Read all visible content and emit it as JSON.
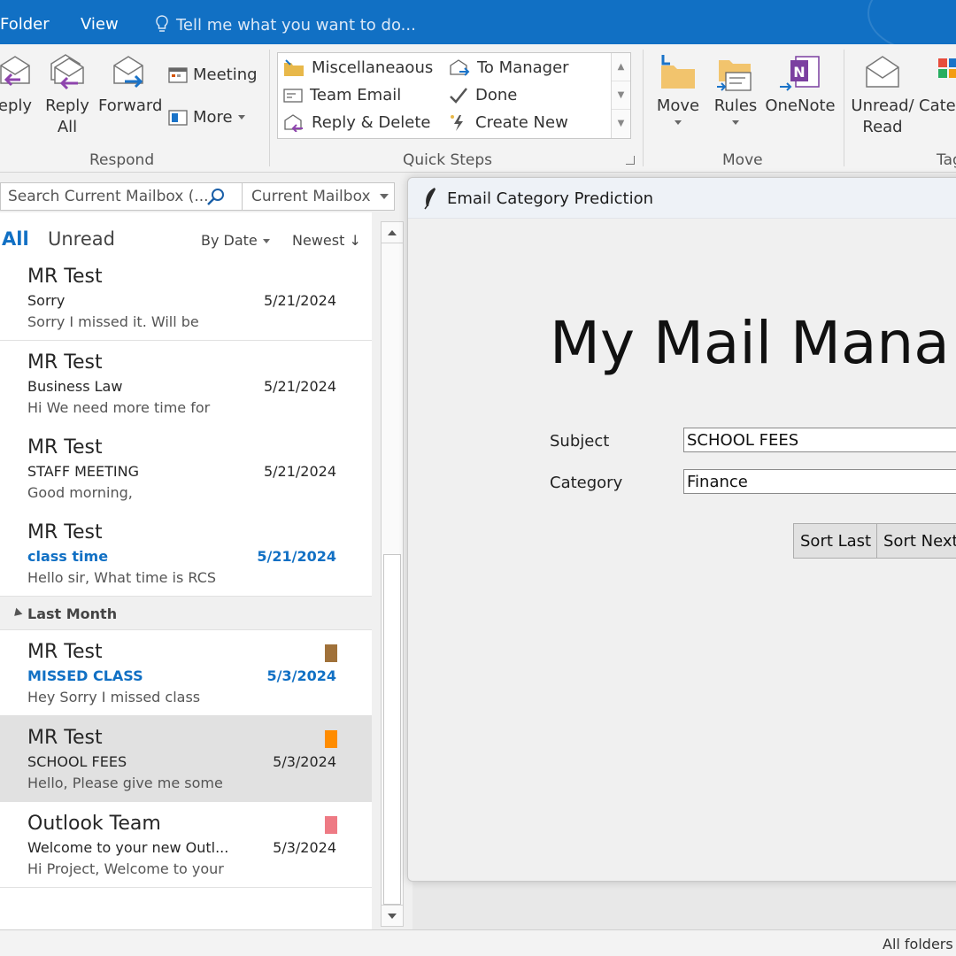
{
  "menubar": {
    "folder": "Folder",
    "view": "View",
    "tell_me": "Tell me what you want to do..."
  },
  "ribbon": {
    "respond": {
      "reply": "eply",
      "reply_all_1": "Reply",
      "reply_all_2": "All",
      "forward": "Forward",
      "meeting": "Meeting",
      "more": "More",
      "label": "Respond"
    },
    "quick_steps": {
      "items": [
        "Miscellaneaous",
        "Team Email",
        "Reply & Delete",
        "To Manager",
        "Done",
        "Create New"
      ],
      "label": "Quick Steps"
    },
    "move": {
      "move": "Move",
      "rules": "Rules",
      "onenote": "OneNote",
      "label": "Move"
    },
    "tags": {
      "unread_1": "Unread/",
      "unread_2": "Read",
      "categorize": "Categ",
      "label": "Tag"
    }
  },
  "search": {
    "placeholder": "Search Current Mailbox (...",
    "scope": "Current Mailbox"
  },
  "list": {
    "filter_all": "All",
    "filter_unread": "Unread",
    "sort_by": "By Date",
    "sort_order": "Newest",
    "group_last_month": "Last Month",
    "messages": [
      {
        "sender": "MR Test",
        "subject": "Sorry",
        "preview": "Sorry I missed it. Will be",
        "date": "5/21/2024"
      },
      {
        "sender": "MR Test",
        "subject": "Business Law",
        "preview": "Hi  We need more time for",
        "date": "5/21/2024"
      },
      {
        "sender": "MR Test",
        "subject": "STAFF MEETING",
        "preview": "Good morning,",
        "date": "5/21/2024"
      },
      {
        "sender": "MR Test",
        "subject": "class time",
        "preview": "Hello sir,  What time is RCS",
        "date": "5/21/2024"
      },
      {
        "sender": "MR Test",
        "subject": "MISSED CLASS",
        "preview": "Hey  Sorry I missed class",
        "date": "5/3/2024"
      },
      {
        "sender": "MR Test",
        "subject": "SCHOOL FEES",
        "preview": "Hello,  Please give me some",
        "date": "5/3/2024"
      },
      {
        "sender": "Outlook Team",
        "subject": "Welcome to your new Outl...",
        "preview": "Hi Project,  Welcome to your",
        "date": "5/3/2024"
      }
    ]
  },
  "colors": {
    "accent": "#1170c4",
    "cat_brown": "#a0713a",
    "cat_orange": "#ff8c00",
    "cat_pink": "#ee7a84"
  },
  "dialog": {
    "title": "Email Category Prediction",
    "heading": "My Mail Mana",
    "subject_label": "Subject",
    "subject_value": "SCHOOL FEES",
    "category_label": "Category",
    "category_value": "Finance",
    "sort_last": "Sort Last",
    "sort_next": "Sort Next"
  },
  "status": {
    "text": "All folders"
  }
}
